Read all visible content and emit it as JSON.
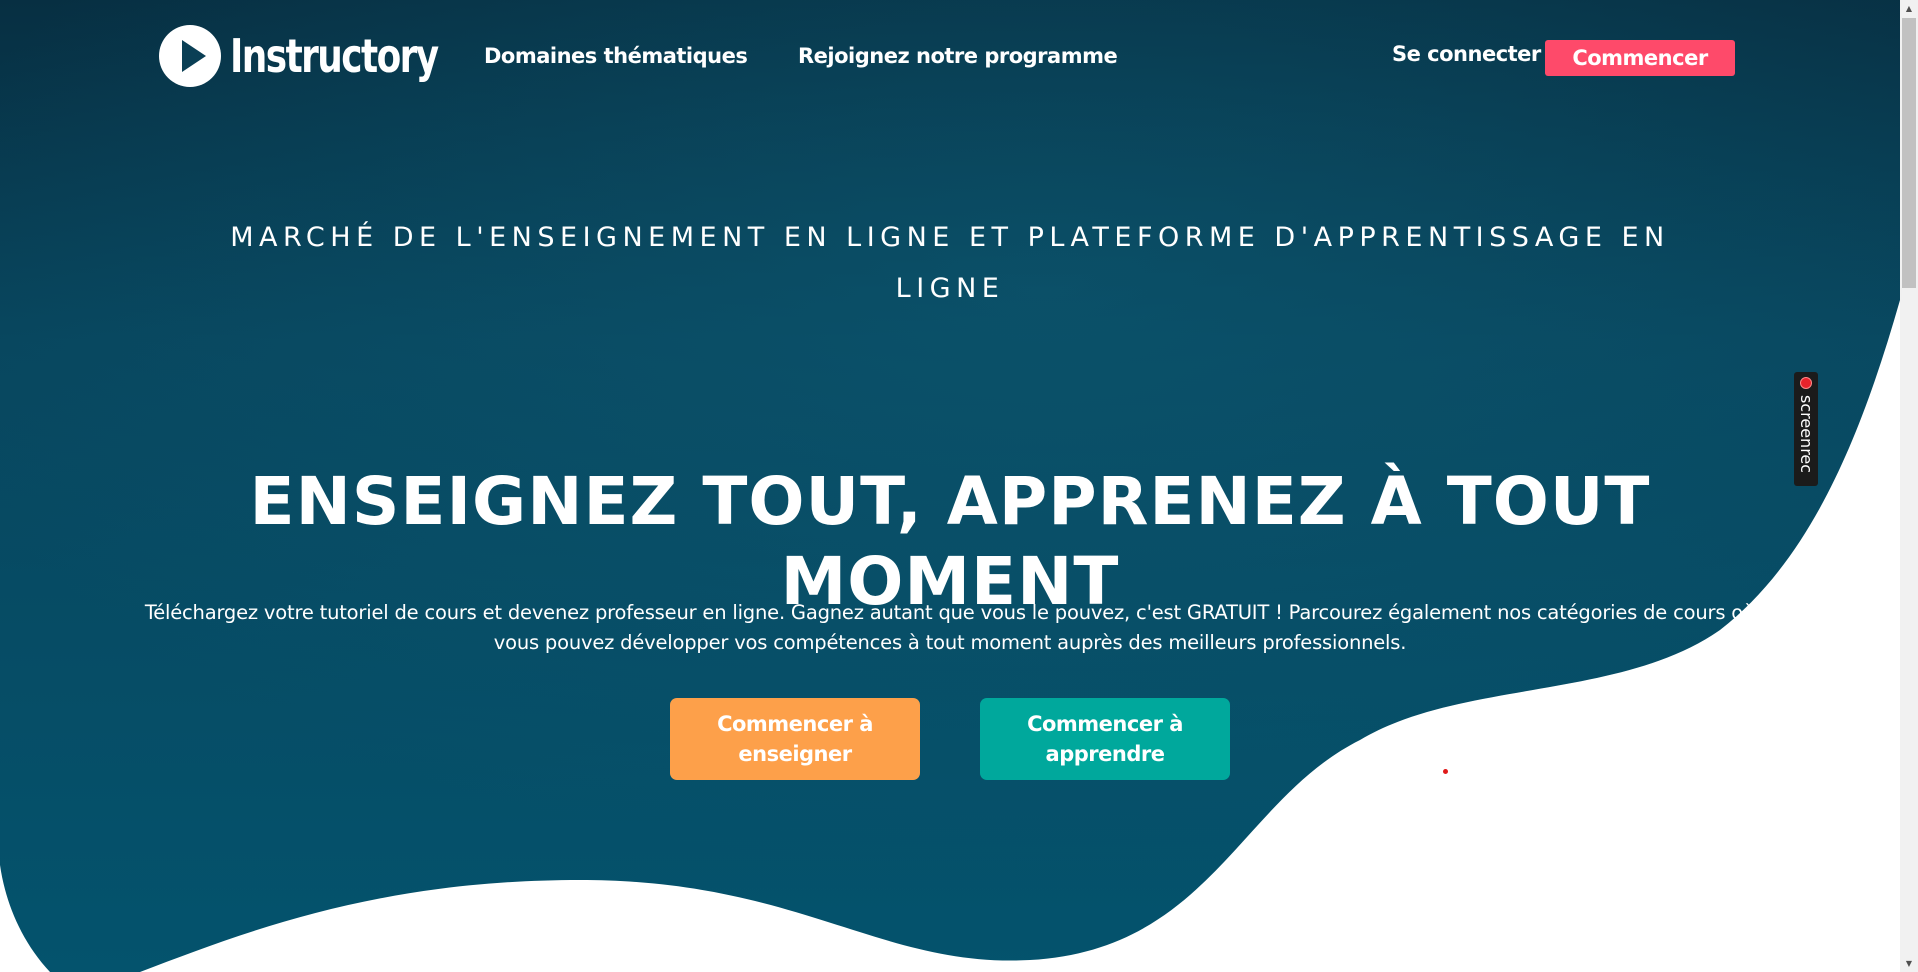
{
  "header": {
    "logo_text": "Instructory",
    "nav": {
      "topics": "Domaines thématiques",
      "join": "Rejoignez notre programme"
    },
    "login": "Se connecter",
    "start": "Commencer"
  },
  "hero": {
    "eyebrow": "MARCHÉ DE L'ENSEIGNEMENT EN LIGNE ET PLATEFORME D'APPRENTISSAGE EN LIGNE",
    "title": "ENSEIGNEZ TOUT, APPRENEZ À TOUT MOMENT",
    "description": "Téléchargez votre tutoriel de cours et devenez professeur en ligne. Gagnez autant que vous le pouvez, c'est GRATUIT ! Parcourez également nos catégories de cours où vous pouvez développer vos compétences à tout moment auprès des meilleurs professionnels.",
    "cta_teach": "Commencer à enseigner",
    "cta_learn": "Commencer à apprendre"
  },
  "widget": {
    "label": "screenrec",
    "icon": "record-icon"
  },
  "colors": {
    "hero_dark": "#0b4258",
    "hero_mid": "#055570",
    "start_button": "#fe4a6a",
    "teach_button": "#fda04a",
    "learn_button": "#00a89c"
  }
}
